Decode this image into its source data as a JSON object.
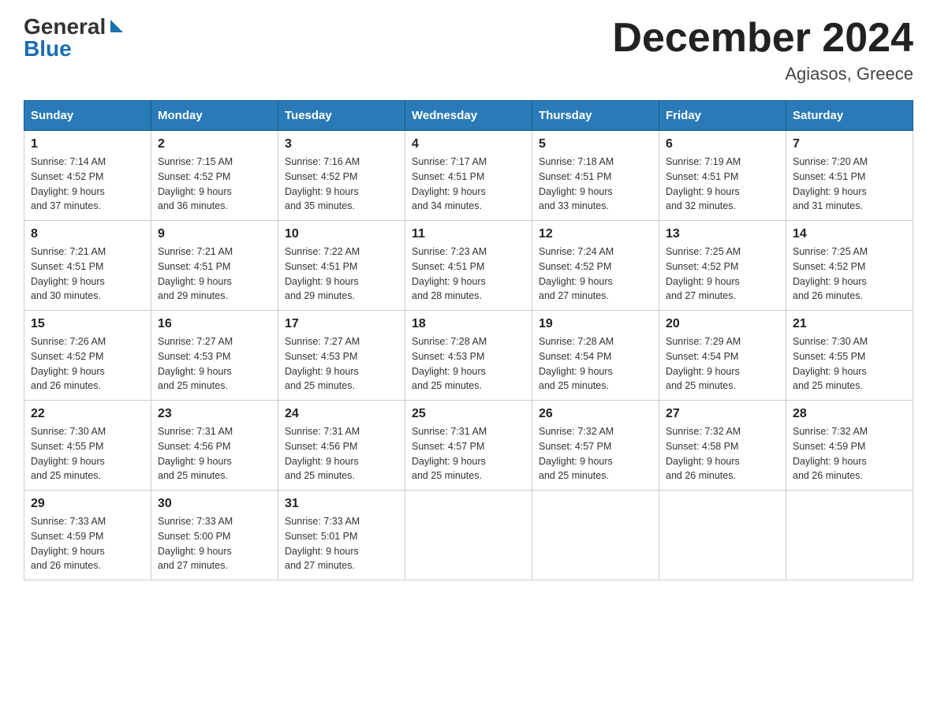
{
  "header": {
    "logo": {
      "general": "General",
      "arrow": "▶",
      "blue": "Blue"
    },
    "title": "December 2024",
    "location": "Agiasos, Greece"
  },
  "calendar": {
    "days_of_week": [
      "Sunday",
      "Monday",
      "Tuesday",
      "Wednesday",
      "Thursday",
      "Friday",
      "Saturday"
    ],
    "weeks": [
      [
        {
          "day": "1",
          "sunrise": "7:14 AM",
          "sunset": "4:52 PM",
          "daylight": "9 hours and 37 minutes."
        },
        {
          "day": "2",
          "sunrise": "7:15 AM",
          "sunset": "4:52 PM",
          "daylight": "9 hours and 36 minutes."
        },
        {
          "day": "3",
          "sunrise": "7:16 AM",
          "sunset": "4:52 PM",
          "daylight": "9 hours and 35 minutes."
        },
        {
          "day": "4",
          "sunrise": "7:17 AM",
          "sunset": "4:51 PM",
          "daylight": "9 hours and 34 minutes."
        },
        {
          "day": "5",
          "sunrise": "7:18 AM",
          "sunset": "4:51 PM",
          "daylight": "9 hours and 33 minutes."
        },
        {
          "day": "6",
          "sunrise": "7:19 AM",
          "sunset": "4:51 PM",
          "daylight": "9 hours and 32 minutes."
        },
        {
          "day": "7",
          "sunrise": "7:20 AM",
          "sunset": "4:51 PM",
          "daylight": "9 hours and 31 minutes."
        }
      ],
      [
        {
          "day": "8",
          "sunrise": "7:21 AM",
          "sunset": "4:51 PM",
          "daylight": "9 hours and 30 minutes."
        },
        {
          "day": "9",
          "sunrise": "7:21 AM",
          "sunset": "4:51 PM",
          "daylight": "9 hours and 29 minutes."
        },
        {
          "day": "10",
          "sunrise": "7:22 AM",
          "sunset": "4:51 PM",
          "daylight": "9 hours and 29 minutes."
        },
        {
          "day": "11",
          "sunrise": "7:23 AM",
          "sunset": "4:51 PM",
          "daylight": "9 hours and 28 minutes."
        },
        {
          "day": "12",
          "sunrise": "7:24 AM",
          "sunset": "4:52 PM",
          "daylight": "9 hours and 27 minutes."
        },
        {
          "day": "13",
          "sunrise": "7:25 AM",
          "sunset": "4:52 PM",
          "daylight": "9 hours and 27 minutes."
        },
        {
          "day": "14",
          "sunrise": "7:25 AM",
          "sunset": "4:52 PM",
          "daylight": "9 hours and 26 minutes."
        }
      ],
      [
        {
          "day": "15",
          "sunrise": "7:26 AM",
          "sunset": "4:52 PM",
          "daylight": "9 hours and 26 minutes."
        },
        {
          "day": "16",
          "sunrise": "7:27 AM",
          "sunset": "4:53 PM",
          "daylight": "9 hours and 25 minutes."
        },
        {
          "day": "17",
          "sunrise": "7:27 AM",
          "sunset": "4:53 PM",
          "daylight": "9 hours and 25 minutes."
        },
        {
          "day": "18",
          "sunrise": "7:28 AM",
          "sunset": "4:53 PM",
          "daylight": "9 hours and 25 minutes."
        },
        {
          "day": "19",
          "sunrise": "7:28 AM",
          "sunset": "4:54 PM",
          "daylight": "9 hours and 25 minutes."
        },
        {
          "day": "20",
          "sunrise": "7:29 AM",
          "sunset": "4:54 PM",
          "daylight": "9 hours and 25 minutes."
        },
        {
          "day": "21",
          "sunrise": "7:30 AM",
          "sunset": "4:55 PM",
          "daylight": "9 hours and 25 minutes."
        }
      ],
      [
        {
          "day": "22",
          "sunrise": "7:30 AM",
          "sunset": "4:55 PM",
          "daylight": "9 hours and 25 minutes."
        },
        {
          "day": "23",
          "sunrise": "7:31 AM",
          "sunset": "4:56 PM",
          "daylight": "9 hours and 25 minutes."
        },
        {
          "day": "24",
          "sunrise": "7:31 AM",
          "sunset": "4:56 PM",
          "daylight": "9 hours and 25 minutes."
        },
        {
          "day": "25",
          "sunrise": "7:31 AM",
          "sunset": "4:57 PM",
          "daylight": "9 hours and 25 minutes."
        },
        {
          "day": "26",
          "sunrise": "7:32 AM",
          "sunset": "4:57 PM",
          "daylight": "9 hours and 25 minutes."
        },
        {
          "day": "27",
          "sunrise": "7:32 AM",
          "sunset": "4:58 PM",
          "daylight": "9 hours and 26 minutes."
        },
        {
          "day": "28",
          "sunrise": "7:32 AM",
          "sunset": "4:59 PM",
          "daylight": "9 hours and 26 minutes."
        }
      ],
      [
        {
          "day": "29",
          "sunrise": "7:33 AM",
          "sunset": "4:59 PM",
          "daylight": "9 hours and 26 minutes."
        },
        {
          "day": "30",
          "sunrise": "7:33 AM",
          "sunset": "5:00 PM",
          "daylight": "9 hours and 27 minutes."
        },
        {
          "day": "31",
          "sunrise": "7:33 AM",
          "sunset": "5:01 PM",
          "daylight": "9 hours and 27 minutes."
        },
        null,
        null,
        null,
        null
      ]
    ],
    "labels": {
      "sunrise": "Sunrise:",
      "sunset": "Sunset:",
      "daylight": "Daylight:"
    }
  }
}
